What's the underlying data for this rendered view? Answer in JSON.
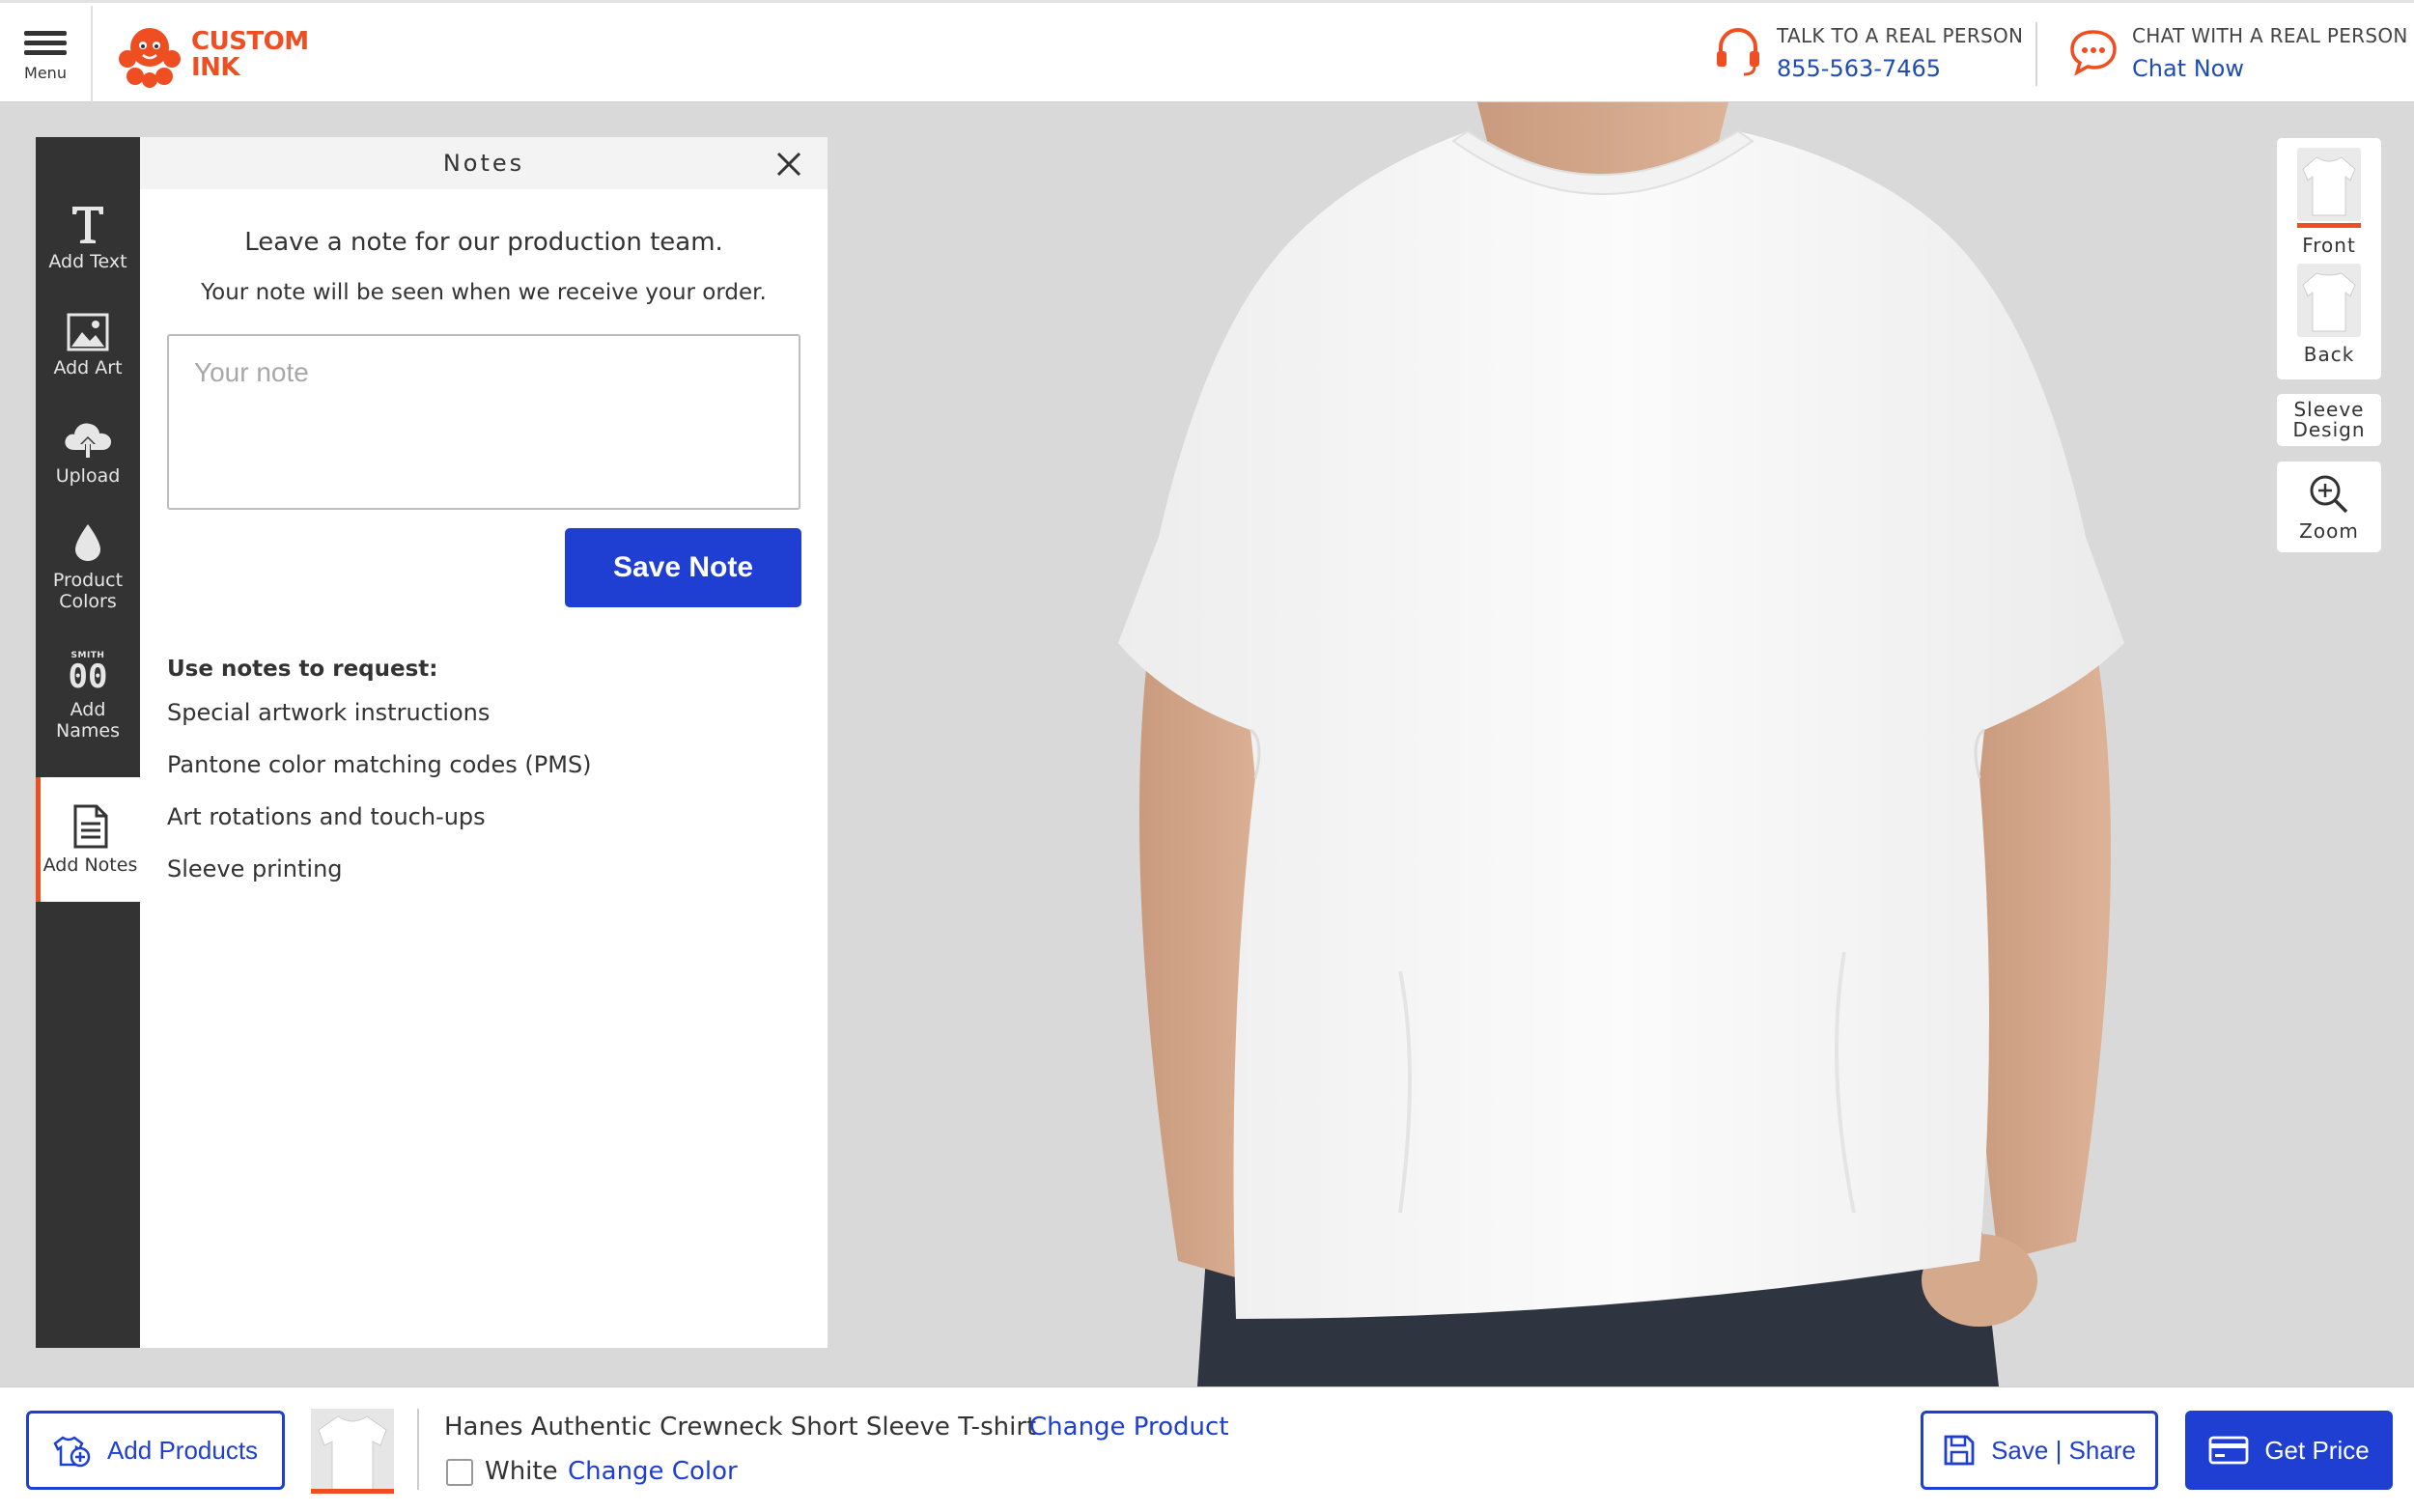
{
  "header": {
    "menu_label": "Menu",
    "logo_line1": "CUSTOM",
    "logo_line2": "INK",
    "phone": {
      "label": "TALK TO A REAL PERSON",
      "number": "855-563-7465"
    },
    "chat": {
      "label": "CHAT WITH A REAL PERSON",
      "link": "Chat Now"
    }
  },
  "toolbar": {
    "items": [
      {
        "label": "Add Text",
        "icon": "text-icon"
      },
      {
        "label": "Add Art",
        "icon": "image-icon"
      },
      {
        "label": "Upload",
        "icon": "cloud-upload-icon"
      },
      {
        "label": "Product Colors",
        "icon": "color-drop-icon"
      },
      {
        "label": "Add Names",
        "icon": "names-numbers-icon"
      },
      {
        "label": "Add Notes",
        "icon": "notes-icon"
      }
    ],
    "names_icon_text": "SMITH",
    "names_icon_number": "00"
  },
  "notes_panel": {
    "title": "Notes",
    "lead": "Leave a note for our production team.",
    "sub": "Your note will be seen when we receive your order.",
    "input_placeholder": "Your note",
    "input_value": "",
    "save_label": "Save Note",
    "requests_title": "Use notes to request:",
    "requests": [
      "Special artwork instructions",
      "Pantone color matching codes (PMS)",
      "Art rotations and touch-ups",
      "Sleeve printing"
    ]
  },
  "views": {
    "front": "Front",
    "back": "Back",
    "sleeve": "Sleeve Design",
    "zoom": "Zoom"
  },
  "bottom": {
    "add_products": "Add Products",
    "product_name": "Hanes Authentic Crewneck Short Sleeve T-shirt",
    "change_product": "Change Product",
    "color": "White",
    "change_color": "Change Color",
    "save_share": "Save | Share",
    "get_price": "Get Price"
  },
  "colors": {
    "brand": "#ef4e23",
    "primary": "#1e3fd1",
    "link": "#1f4db3",
    "toolbar_bg": "#333333"
  }
}
